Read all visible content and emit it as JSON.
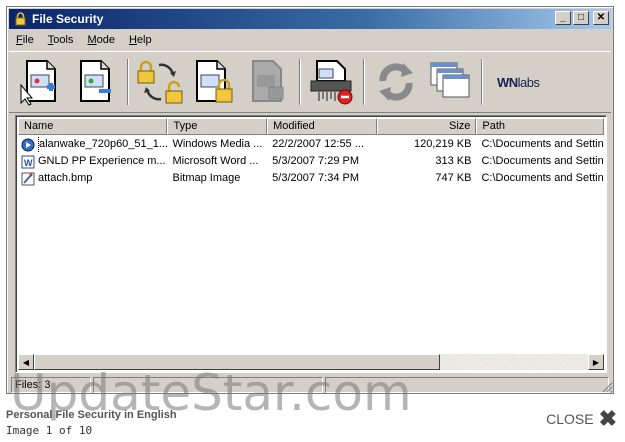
{
  "window": {
    "title": "File Security",
    "buttons": {
      "minimize": "_",
      "maximize": "□",
      "close": "✕"
    }
  },
  "menu": [
    {
      "label": "File",
      "accel": "F",
      "rest": "ile"
    },
    {
      "label": "Tools",
      "accel": "T",
      "rest": "ools"
    },
    {
      "label": "Mode",
      "accel": "M",
      "rest": "ode"
    },
    {
      "label": "Help",
      "accel": "H",
      "rest": "elp"
    }
  ],
  "toolbar": {
    "brand_bold": "WN",
    "brand_rest": "labs"
  },
  "columns": {
    "name": "Name",
    "type": "Type",
    "modified": "Modified",
    "size": "Size",
    "path": "Path"
  },
  "rows": [
    {
      "name": "alanwake_720p60_51_1...",
      "type": "Windows Media ...",
      "modified": "22/2/2007 12:55 ...",
      "size": "120,219 KB",
      "path": "C:\\Documents and Settings"
    },
    {
      "name": "GNLD PP Experience m...",
      "type": "Microsoft Word ...",
      "modified": "5/3/2007 7:29 PM",
      "size": "313 KB",
      "path": "C:\\Documents and Settings"
    },
    {
      "name": "attach.bmp",
      "type": "Bitmap Image",
      "modified": "5/3/2007 7:34 PM",
      "size": "747 KB",
      "path": "C:\\Documents and Settings"
    }
  ],
  "status": {
    "files": "Files: 3"
  },
  "watermark": "UpdateStar.com",
  "caption": {
    "title": "Personal File Security in English",
    "sub": "Image 1 of 10",
    "close": "CLOSE"
  },
  "colors": {
    "titlebar_start": "#0a246a",
    "titlebar_end": "#a6caf0",
    "face": "#d4d0c8"
  }
}
